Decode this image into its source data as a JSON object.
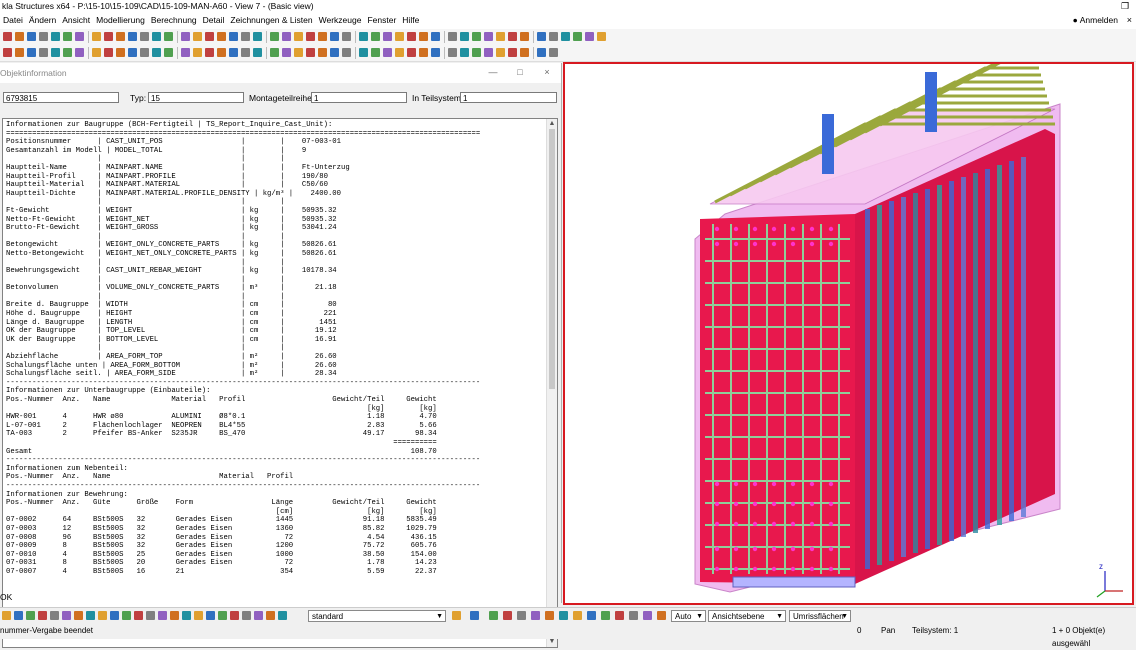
{
  "window": {
    "title": "kla Structures x64 - P:\\15-10\\15-109\\CAD\\15-109-MAN-A60 - View 7 - (Basic view)"
  },
  "menu": {
    "items": [
      "Datei",
      "Ändern",
      "Ansicht",
      "Modellierung",
      "Berechnung",
      "Detail",
      "Zeichnungen & Listen",
      "Werkzeuge",
      "Fenster",
      "Hilfe"
    ],
    "login": "Anmelden"
  },
  "dialog": {
    "title": "Objektinformation",
    "id_value": "6793815",
    "type_label": "Typ:",
    "type_value": "15",
    "assembly_label": "Montageteilreihe:",
    "assembly_value": "1",
    "subsystem_label": "In Teilsystem:",
    "subsystem_value": "1",
    "ok_label": "OK"
  },
  "report": {
    "text": "Informationen zur Baugruppe (BCH-Fertigteil | TS_Report_Inquire_Cast_Unit):\n=============================================================================================================\nPositionsnummer      | CAST_UNIT_POS                  |        |    07-003-01\nGesamtanzahl im Modell | MODEL_TOTAL                  |        |    9\n                     |                                |        |\nHauptteil-Name       | MAINPART.NAME                  |        |    Ft-Unterzug\nHauptteil-Profil     | MAINPART.PROFILE               |        |    190/80\nHauptteil-Material   | MAINPART.MATERIAL              |        |    C50/60\nHauptteil-Dichte     | MAINPART.MATERIAL.PROFILE_DENSITY | kg/m³ |    2400.00\n                     |                                |        |\nFt-Gewicht           | WEIGHT                         | kg     |    50935.32\nNetto-Ft-Gewicht     | WEIGHT_NET                     | kg     |    50935.32\nBrutto-Ft-Gewicht    | WEIGHT_GROSS                   | kg     |    53041.24\n                     |                                |        |\nBetongewicht         | WEIGHT_ONLY_CONCRETE_PARTS     | kg     |    50826.61\nNetto-Betongewicht   | WEIGHT_NET_ONLY_CONCRETE_PARTS | kg     |    50826.61\n                     |                                |        |\nBewehrungsgewicht    | CAST_UNIT_REBAR_WEIGHT         | kg     |    10178.34\n                     |                                |        |\nBetonvolumen         | VOLUME_ONLY_CONCRETE_PARTS     | m³     |       21.18\n                     |                                |        |\nBreite d. Baugruppe  | WIDTH                          | cm     |          80\nHöhe d. Baugruppe    | HEIGHT                         | cm     |         221\nLänge d. Baugruppe   | LENGTH                         | cm     |        1451\nOK der Baugruppe     | TOP_LEVEL                      | cm     |       19.12\nUK der Baugruppe     | BOTTOM_LEVEL                   | cm     |       16.91\n                     |                                |        |\nAbziehfläche         | AREA_FORM_TOP                  | m²     |       26.60\nSchalungsfläche unten | AREA_FORM_BOTTOM              | m²     |       26.60\nSchalungsfläche seitl. | AREA_FORM_SIDE               | m²     |       28.34\n-------------------------------------------------------------------------------------------------------------\nInformationen zur Unterbaugruppe (Einbauteile):\nPos.-Nummer  Anz.   Name              Material   Profil                    Gewicht/Teil     Gewicht\n                                                                                   [kg]        [kg]\nHWR-001      4      HWR ø80           ALUMINI    Ø8*0.1                            1.18        4.70\nL-07-001     2      Flächenlochlager  NEOPREN    BL4*55                            2.83        5.66\nTA-003       2      Pfeifer BS-Anker  S235JR     BS_470                           49.17       98.34\n                                                                                         ==========\nGesamt                                                                                       108.70\n-------------------------------------------------------------------------------------------------------------\nInformationen zum Nebenteil:\nPos.-Nummer  Anz.   Name                         Material   Profil\n-------------------------------------------------------------------------------------------------------------\nInformationen zur Bewehrung:\nPos.-Nummer  Anz.   Güte      Größe    Form                  Länge         Gewicht/Teil     Gewicht\n                                                              [cm]                 [kg]        [kg]\n07-0002      64     BSt500S   32       Gerades Eisen          1445                91.18     5835.49\n07-0003      12     BSt500S   32       Gerades Eisen          1360                85.82     1029.79\n07-0008      96     BSt500S   32       Gerades Eisen            72                 4.54      436.15\n07-0009      8      BSt500S   32       Gerades Eisen          1200                75.72      605.76\n07-0010      4      BSt500S   25       Gerades Eisen          1000                38.50      154.00\n07-0031      8      BSt500S   20       Gerades Eisen            72                 1.78       14.23\n07-0007      4      BSt500S   16       21                      354                 5.59       22.37"
  },
  "bottombar": {
    "combo_standard": "standard",
    "combo_auto": "Auto",
    "combo_view": "Ansichtsebene",
    "combo_outline": "Umrissflächen"
  },
  "statusbar": {
    "left": "nummer-Vergabe beendet",
    "zero": "0",
    "pan": "Pan",
    "subsystem": "Teilsystem: 1",
    "selection": "1 + 0 Objekt(e) ausgewähl"
  },
  "colors": {
    "viewport_border": "#d71920",
    "concrete": "#e8184d",
    "rebar": "#8fcf9a",
    "embed": "#3a6ad8",
    "hull": "#e9a6e9"
  }
}
